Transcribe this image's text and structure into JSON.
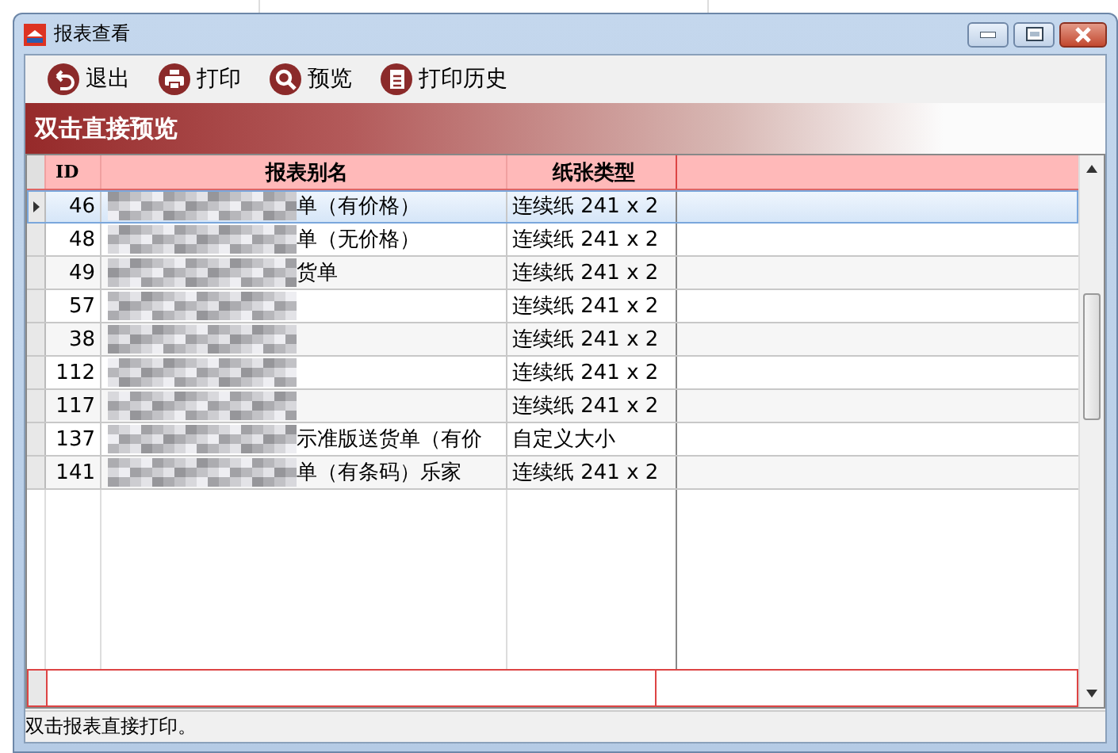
{
  "window": {
    "title": "报表查看"
  },
  "toolbar": [
    {
      "kind": "exit",
      "label": "退出"
    },
    {
      "kind": "print",
      "label": "打印"
    },
    {
      "kind": "preview",
      "label": "预览"
    },
    {
      "kind": "history",
      "label": "打印历史"
    }
  ],
  "banner": "双击直接预览",
  "table": {
    "columns": [
      "ID",
      "报表别名",
      "纸张类型"
    ],
    "rows": [
      {
        "id": "46",
        "name": "单（有价格）",
        "paper": "连续纸 241 x 2",
        "selected": true
      },
      {
        "id": "48",
        "name": "单（无价格）",
        "paper": "连续纸 241 x 2",
        "selected": false
      },
      {
        "id": "49",
        "name": "货单",
        "paper": "连续纸 241 x 2",
        "selected": false
      },
      {
        "id": "57",
        "paper": "连续纸 241 x 2",
        "selected": false
      },
      {
        "id": "38",
        "paper": "连续纸 241 x 2",
        "selected": false
      },
      {
        "id": "112",
        "paper": "连续纸 241 x 2",
        "selected": false
      },
      {
        "id": "117",
        "paper": "连续纸 241 x 2",
        "selected": false
      },
      {
        "id": "137",
        "name": "示准版送货单（有价",
        "paper": "自定义大小",
        "selected": false
      },
      {
        "id": "141",
        "name": "单（有条码）乐家",
        "paper": "连续纸 241 x 2",
        "selected": false
      }
    ]
  },
  "status_bar": "双击报表直接打印。"
}
